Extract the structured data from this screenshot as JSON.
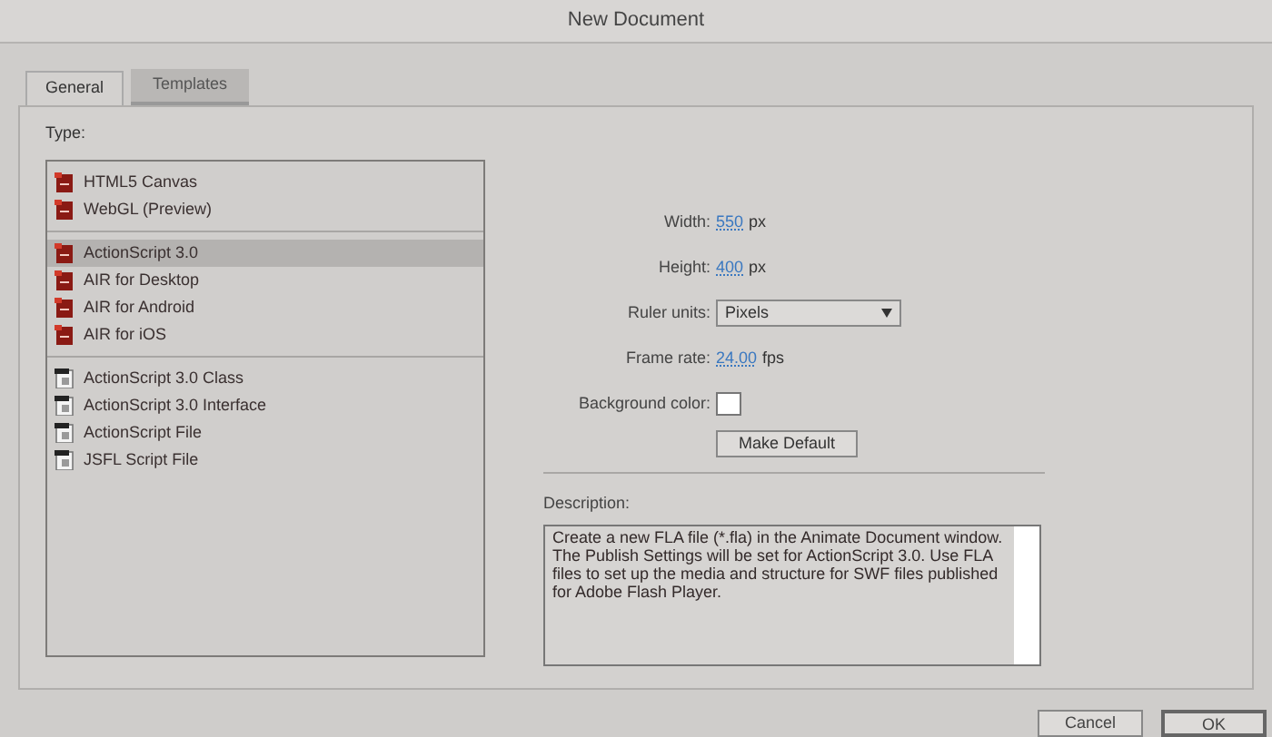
{
  "window": {
    "title": "New Document"
  },
  "tabs": [
    {
      "label": "General",
      "selected": true
    },
    {
      "label": "Templates",
      "selected": false
    }
  ],
  "type_label": "Type:",
  "type_groups": [
    [
      {
        "label": "HTML5 Canvas",
        "kind": "document",
        "selected": false
      },
      {
        "label": "WebGL (Preview)",
        "kind": "document",
        "selected": false
      }
    ],
    [
      {
        "label": "ActionScript 3.0",
        "kind": "document",
        "selected": true
      },
      {
        "label": "AIR for Desktop",
        "kind": "document",
        "selected": false
      },
      {
        "label": "AIR for Android",
        "kind": "document",
        "selected": false
      },
      {
        "label": "AIR for iOS",
        "kind": "document",
        "selected": false
      }
    ],
    [
      {
        "label": "ActionScript 3.0 Class",
        "kind": "script",
        "selected": false
      },
      {
        "label": "ActionScript 3.0 Interface",
        "kind": "script",
        "selected": false
      },
      {
        "label": "ActionScript File",
        "kind": "script",
        "selected": false
      },
      {
        "label": "JSFL Script File",
        "kind": "script",
        "selected": false
      }
    ]
  ],
  "settings": [
    {
      "kind": "number",
      "label": "Width:",
      "value": "550",
      "unit": "px"
    },
    {
      "kind": "number",
      "label": "Height:",
      "value": "400",
      "unit": "px"
    },
    {
      "kind": "select",
      "label": "Ruler units:",
      "value": "Pixels"
    },
    {
      "kind": "number",
      "label": "Frame rate:",
      "value": "24.00",
      "unit": "fps"
    },
    {
      "kind": "color",
      "label": "Background color:",
      "color": "#ffffff"
    }
  ],
  "make_default_button": "Make Default",
  "description": {
    "label": "Description:",
    "text": "Create a new FLA file (*.fla) in the Animate Document window. The Publish Settings will be set for ActionScript 3.0. Use FLA files to set up the media and structure for SWF files published for Adobe Flash Player."
  },
  "buttons": [
    "Cancel",
    "OK"
  ]
}
